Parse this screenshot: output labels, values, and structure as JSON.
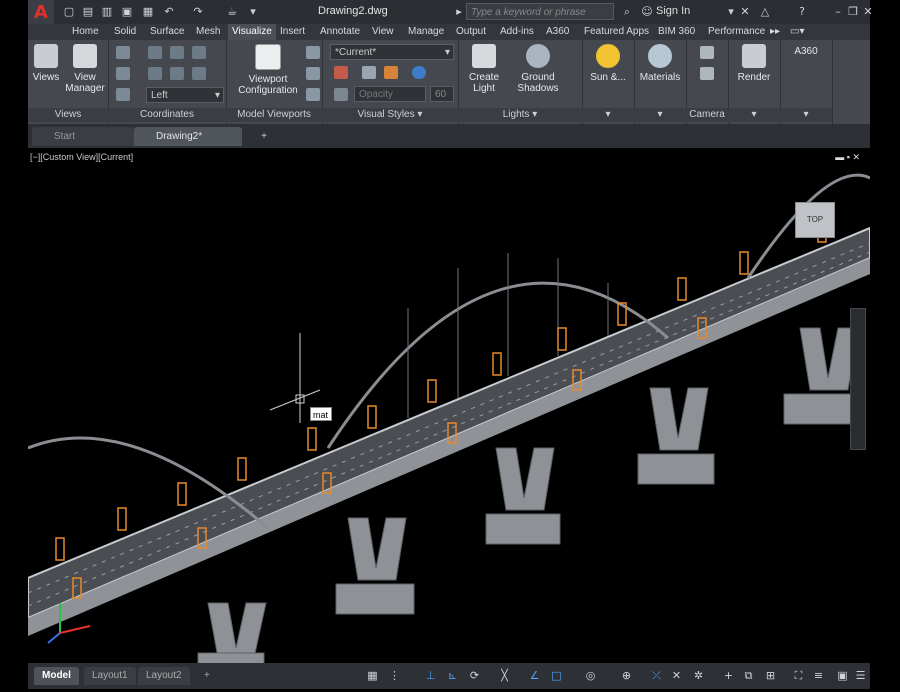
{
  "title_bar": {
    "app_logo": "A",
    "document_title": "Drawing2.dwg",
    "search_placeholder": "Type a keyword or phrase",
    "sign_in": "Sign In"
  },
  "ribbon_tabs": [
    "Home",
    "Solid",
    "Surface",
    "Mesh",
    "Visualize",
    "Insert",
    "Annotate",
    "View",
    "Manage",
    "Output",
    "Add-ins",
    "A360",
    "Featured Apps",
    "BIM 360",
    "Performance"
  ],
  "active_tab": "Visualize",
  "panels": {
    "views": {
      "title": "Views",
      "btn": "Views"
    },
    "view_manager": {
      "label1": "View",
      "label2": "Manager"
    },
    "coordinates": {
      "title": "Coordinates",
      "dropdown": "Left"
    },
    "model_viewports": {
      "title": "Model Viewports",
      "btn1": "Viewport",
      "btn2": "Configuration"
    },
    "visual_styles": {
      "title": "Visual Styles",
      "dropdown": "*Current*",
      "opacity_label": "Opacity",
      "opacity_value": "60"
    },
    "lights": {
      "title": "Lights",
      "create1": "Create",
      "create2": "Light",
      "ground1": "Ground",
      "ground2": "Shadows"
    },
    "sun": {
      "label": "Sun &..."
    },
    "materials": {
      "label": "Materials"
    },
    "camera": {
      "title": "Camera"
    },
    "render": {
      "label": "Render"
    },
    "a360": {
      "label": "A360"
    }
  },
  "file_tabs": [
    "Start",
    "Drawing2*"
  ],
  "active_file_tab": "Drawing2*",
  "viewport": {
    "label": "[−][Custom View][Current]",
    "viewcube_face": "TOP",
    "command_tooltip": "mat"
  },
  "layout_tabs": [
    "Model",
    "Layout1",
    "Layout2"
  ],
  "active_layout": "Model",
  "colors": {
    "accent_logo": "#e0302a",
    "tower_orange": "#e8892b",
    "bridge_grey": "#a9adb2"
  }
}
